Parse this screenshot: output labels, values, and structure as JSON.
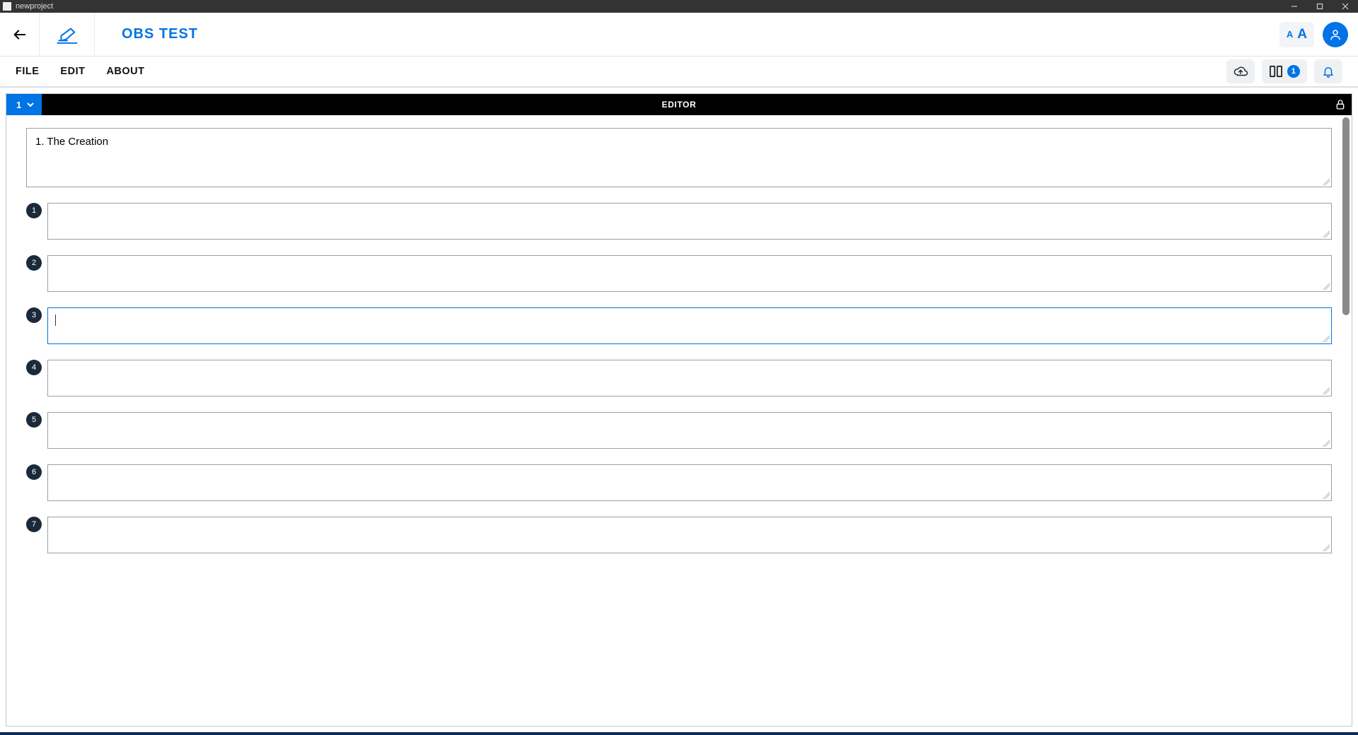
{
  "window": {
    "title": "newproject"
  },
  "header": {
    "project_title": "OBS TEST"
  },
  "menus": {
    "file": "FILE",
    "edit": "EDIT",
    "about": "ABOUT"
  },
  "toolbar": {
    "column_badge": "1"
  },
  "editor": {
    "tab_number": "1",
    "panel_title": "EDITOR",
    "title_field": "1. The Creation",
    "active_row_index": 3,
    "rows": [
      {
        "num": "1",
        "value": ""
      },
      {
        "num": "2",
        "value": ""
      },
      {
        "num": "3",
        "value": ""
      },
      {
        "num": "4",
        "value": ""
      },
      {
        "num": "5",
        "value": ""
      },
      {
        "num": "6",
        "value": ""
      },
      {
        "num": "7",
        "value": ""
      }
    ]
  }
}
